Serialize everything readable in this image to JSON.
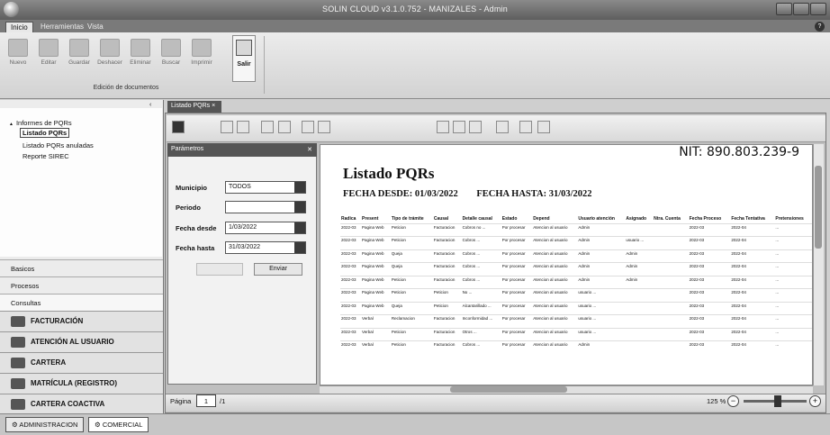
{
  "window": {
    "title": "SOLIN CLOUD v3.1.0.752 - MANIZALES - Admin"
  },
  "ribbon_tabs": [
    "Inicio",
    "Herramientas",
    "Vista"
  ],
  "ribbon": {
    "buttons": [
      "Nuevo",
      "Editar",
      "Guardar",
      "Deshacer",
      "Eliminar",
      "Buscar",
      "Imprimir"
    ],
    "salir_label": "Salir",
    "group_label": "Edición de documentos"
  },
  "tree": {
    "root": "Informes de PQRs",
    "items": [
      "Listado PQRs",
      "Listado PQRs anuladas",
      "Reporte SIREC"
    ]
  },
  "nav": [
    "Basicos",
    "Procesos",
    "Consultas"
  ],
  "modules": [
    "FACTURACIÓN",
    "ATENCIÓN AL USUARIO",
    "CARTERA",
    "MATRÍCULA (REGISTRO)",
    "CARTERA COACTIVA"
  ],
  "bottom_tabs": [
    "ADMINISTRACION",
    "COMERCIAL"
  ],
  "doc_tab": "Listado PQRs",
  "params": {
    "title": "Parámetros",
    "municipio_label": "Municipio",
    "municipio_value": "TODOS",
    "periodo_label": "Periodo",
    "periodo_value": "",
    "fecha_desde_label": "Fecha desde",
    "fecha_desde_value": "1/03/2022",
    "fecha_hasta_label": "Fecha hasta",
    "fecha_hasta_value": "31/03/2022",
    "enviar": "Enviar"
  },
  "report": {
    "nit": "NIT: 890.803.239-9",
    "title": "Listado PQRs",
    "fecha_desde": "FECHA DESDE: 01/03/2022",
    "fecha_hasta": "FECHA HASTA: 31/03/2022",
    "columns": [
      "Radica",
      "Present",
      "Tipo de trámite",
      "Causal",
      "Detalle causal",
      "Estado",
      "Depend",
      "Usuario atención",
      "Asignado",
      "Ntra. Cuenta",
      "Fecha Proceso",
      "Fecha Tentativa",
      "Pretensiones"
    ],
    "rows": [
      [
        "2022-03",
        "Pagina Web",
        "Peticion",
        "Facturacion",
        "Cobros no ...",
        "Por procesar",
        "Atencion al usuario",
        "Admin",
        "",
        "",
        "2022-03",
        "2022-04",
        "..."
      ],
      [
        "2022-03",
        "Pagina Web",
        "Peticion",
        "Facturacion",
        "Cobros ...",
        "Por procesar",
        "Atencion al usuario",
        "Admin",
        "usuario ...",
        "",
        "2022-03",
        "2022-04",
        "..."
      ],
      [
        "2022-03",
        "Pagina Web",
        "Queja",
        "Facturacion",
        "Cobros ...",
        "Por procesar",
        "Atencion al usuario",
        "Admin",
        "Admin",
        "",
        "2022-03",
        "2022-04",
        "..."
      ],
      [
        "2022-03",
        "Pagina Web",
        "Queja",
        "Facturacion",
        "Cobros ...",
        "Por procesar",
        "Atencion al usuario",
        "Admin",
        "Admin",
        "",
        "2022-03",
        "2022-04",
        "..."
      ],
      [
        "2022-03",
        "Pagina Web",
        "Peticion",
        "Facturacion",
        "Cobros ...",
        "Por procesar",
        "Atencion al usuario",
        "Admin",
        "Admin",
        "",
        "2022-03",
        "2022-04",
        "..."
      ],
      [
        "2022-03",
        "Pagina Web",
        "Peticion",
        "Peticion",
        "No ...",
        "Por procesar",
        "Atencion al usuario",
        "usuario ...",
        "",
        "",
        "2022-03",
        "2022-04",
        "..."
      ],
      [
        "2022-03",
        "Pagina Web",
        "Queja",
        "Peticion",
        "Alcantarillado ...",
        "Por procesar",
        "Atencion al usuario",
        "usuario ...",
        "",
        "",
        "2022-03",
        "2022-04",
        "..."
      ],
      [
        "2022-03",
        "Verbal",
        "Reclamacion",
        "Facturacion",
        "Inconformidad ...",
        "Por procesar",
        "Atencion al usuario",
        "usuario ...",
        "",
        "",
        "2022-03",
        "2022-04",
        "..."
      ],
      [
        "2022-03",
        "Verbal",
        "Peticion",
        "Facturacion",
        "Otros ...",
        "Por procesar",
        "Atencion al usuario",
        "usuario ...",
        "",
        "",
        "2022-03",
        "2022-04",
        "..."
      ],
      [
        "2022-03",
        "Verbal",
        "Peticion",
        "Facturacion",
        "Cobros ...",
        "Por procesar",
        "Atencion al usuario",
        "Admin",
        "",
        "",
        "2022-03",
        "2022-04",
        "..."
      ]
    ]
  },
  "status": {
    "pagina_label": "Página",
    "page": "1",
    "total": "/1",
    "zoom": "125 %"
  }
}
